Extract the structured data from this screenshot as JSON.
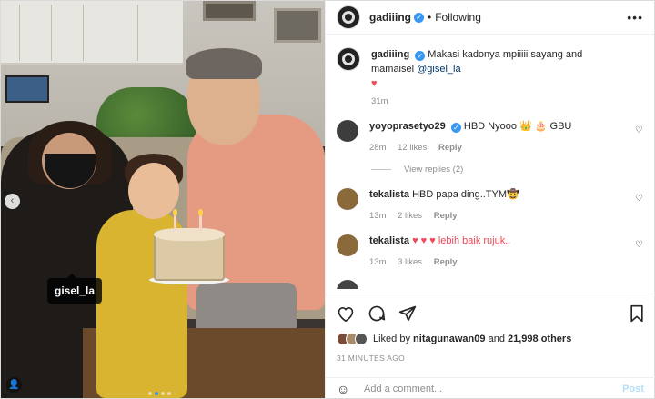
{
  "post": {
    "photo_tag": "gisel_la",
    "carousel_dots": 4,
    "active_dot": 1
  },
  "header": {
    "username": "gadiiing",
    "separator": "•",
    "follow_label": "Following",
    "more_label": "•••"
  },
  "caption": {
    "username": "gadiiing",
    "text": "Makasi kadonya mpiiiii sayang and mamaisel",
    "mention": "@gisel_la",
    "heart": "♥",
    "time": "31m"
  },
  "comments": [
    {
      "username": "yoyoprasetyo29",
      "verified": true,
      "text": "HBD Nyooo 👑 🎂 GBU",
      "time": "28m",
      "likes": "12 likes",
      "reply": "Reply",
      "view_replies": "View replies (2)"
    },
    {
      "username": "tekalista",
      "verified": false,
      "text": "HBD papa ding..TYM🤠",
      "time": "13m",
      "likes": "2 likes",
      "reply": "Reply"
    },
    {
      "username": "tekalista",
      "verified": false,
      "text": "♥ ♥ ♥ lebih baik rujuk..",
      "time": "13m",
      "likes": "3 likes",
      "reply": "Reply"
    }
  ],
  "likes": {
    "prefix": "Liked by",
    "user": "nitagunawan09",
    "and": "and",
    "others": "21,998 others"
  },
  "timestamp": "31 MINUTES AGO",
  "add_comment": {
    "placeholder": "Add a comment...",
    "post_label": "Post"
  },
  "colors": {
    "verified_blue": "#3897f0",
    "like_red": "#ed4956",
    "post_disabled": "#b2dffc"
  }
}
